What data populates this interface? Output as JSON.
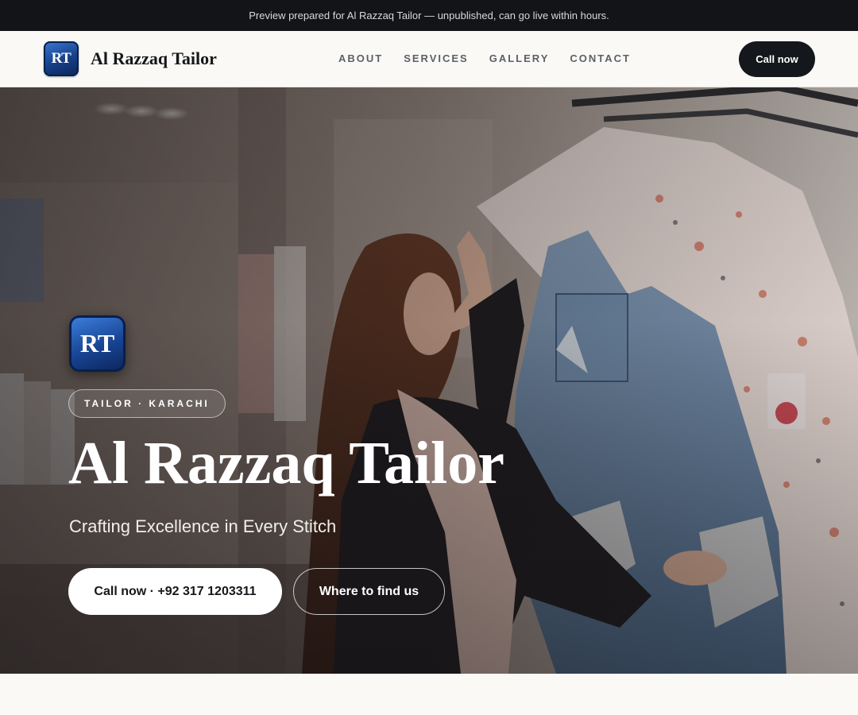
{
  "preview_banner": {
    "text": "Preview prepared for Al Razzaq Tailor — unpublished, can go live within hours."
  },
  "header": {
    "logo_monogram": "RT",
    "brand_name": "Al Razzaq Tailor",
    "nav": [
      {
        "label": "ABOUT"
      },
      {
        "label": "SERVICES"
      },
      {
        "label": "GALLERY"
      },
      {
        "label": "CONTACT"
      }
    ],
    "cta_label": "Call now"
  },
  "hero": {
    "badge_monogram": "RT",
    "tag": "TAILOR · KARACHI",
    "title": "Al Razzaq Tailor",
    "subtitle": "Crafting Excellence in Every Stitch",
    "primary_button": "Call now · +92 317 1203311",
    "secondary_button": "Where to find us"
  },
  "colors": {
    "banner_bg": "#121418",
    "nav_bg": "#faf9f6",
    "accent_dark": "#14171b",
    "logo_blue": "#184494",
    "hero_text": "#ffffff"
  },
  "icons": {
    "logo": "rt-monogram-icon"
  }
}
